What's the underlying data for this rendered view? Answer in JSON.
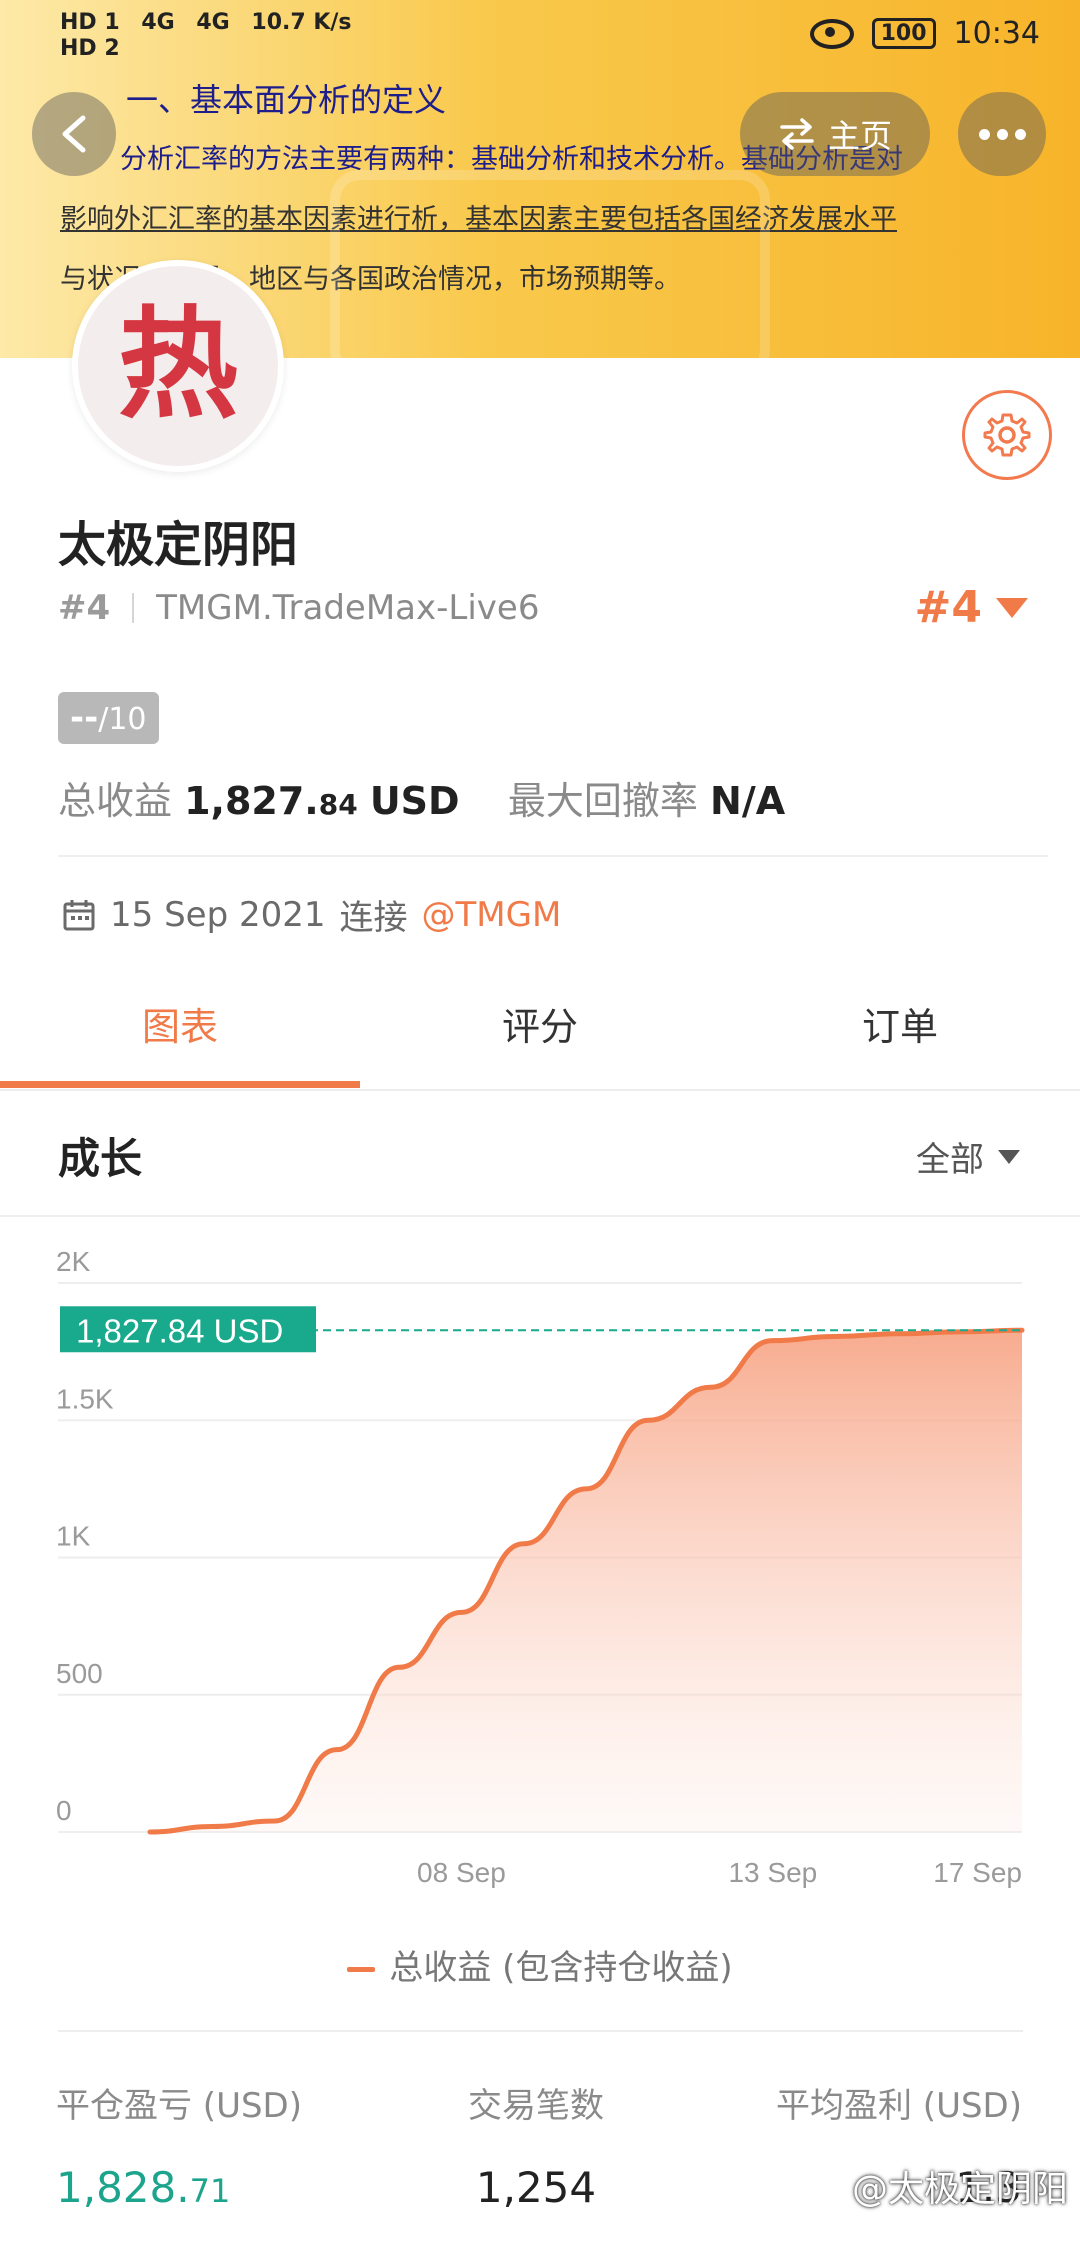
{
  "status_bar": {
    "left": [
      "HD 1",
      "HD 2",
      "4G",
      "4G",
      "10.7 K/s"
    ],
    "battery": "100",
    "time": "10:34"
  },
  "banner": {
    "heading": "一、基本面分析的定义",
    "line1": "分析汇率的方法主要有两种：基础分析和技术分析。基础分析是对",
    "line2": "影响外汇汇率的基本因素进行析，基本因素主要包括各国经济发展水平",
    "line3": "与状况、世界、地区与各国政治情况，市场预期等。",
    "home_label": "主页"
  },
  "profile": {
    "avatar_char": "热",
    "name": "太极定阴阳",
    "rank": "#4",
    "server": "TMGM.TradeMax-Live6",
    "rank_right": "#4",
    "score_value": "--",
    "score_suffix": "/10",
    "total_profit_label": "总收益",
    "total_profit_main": "1,827.",
    "total_profit_decimals": "84",
    "total_profit_currency": "USD",
    "max_drawdown_label": "最大回撤率",
    "max_drawdown_value": "N/A",
    "connect_date": "15 Sep 2021",
    "connect_label": "连接",
    "broker": "@TMGM"
  },
  "tabs": [
    {
      "label": "图表",
      "active": true
    },
    {
      "label": "评分",
      "active": false
    },
    {
      "label": "订单",
      "active": false
    }
  ],
  "section": {
    "title": "成长",
    "filter": "全部"
  },
  "chart_data": {
    "type": "area",
    "x": [
      "03 Sep",
      "04 Sep",
      "05 Sep",
      "06 Sep",
      "07 Sep",
      "08 Sep",
      "09 Sep",
      "10 Sep",
      "11 Sep",
      "12 Sep",
      "13 Sep",
      "14 Sep",
      "15 Sep",
      "16 Sep",
      "17 Sep"
    ],
    "series": [
      {
        "name": "总收益 (包含持仓收益)",
        "values": [
          0,
          20,
          40,
          300,
          600,
          800,
          1050,
          1250,
          1500,
          1620,
          1790,
          1805,
          1815,
          1822,
          1827.84
        ]
      }
    ],
    "x_tick_labels": [
      "08 Sep",
      "13 Sep",
      "17 Sep"
    ],
    "y_tick_labels": [
      "0",
      "500",
      "1K",
      "1.5K",
      "2K"
    ],
    "ylim": [
      0,
      2000
    ],
    "current_label": "1,827.84 USD",
    "grid": true,
    "legend_position": "bottom",
    "colors": {
      "line": "#f07a48",
      "fill": "#f9b9a0",
      "label_bg": "#19a98c"
    }
  },
  "bottom_stats": [
    {
      "label": "平仓盈亏 (USD)",
      "main": "1,828.",
      "decimals": "71"
    },
    {
      "label": "交易笔数",
      "main": "1,254",
      "decimals": ""
    },
    {
      "label": "平均盈利 (USD)",
      "main": "1.3",
      "decimals": ""
    }
  ],
  "watermark": "@太极定阴阳",
  "colors": {
    "accent": "#f07a48",
    "green": "#1da48c"
  }
}
